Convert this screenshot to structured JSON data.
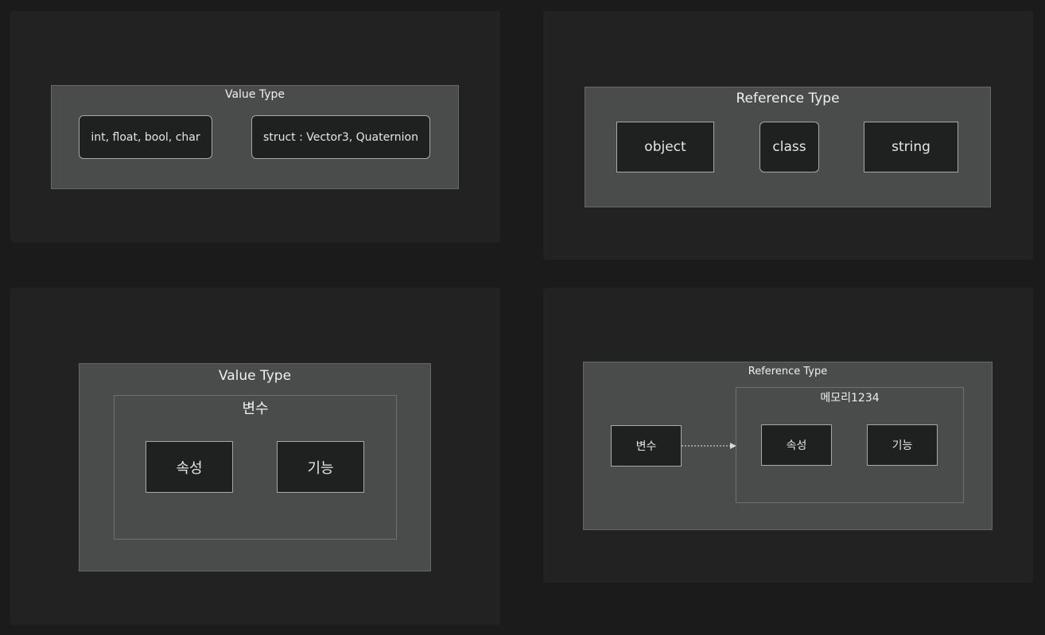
{
  "diagram_1": {
    "group_title": "Value Type",
    "nodes": [
      "int, float, bool, char",
      "struct : Vector3, Quaternion"
    ]
  },
  "diagram_2": {
    "group_title": "Reference Type",
    "nodes": [
      "object",
      "class",
      "string"
    ]
  },
  "diagram_3": {
    "group_title": "Value Type",
    "subgroup_title": "변수",
    "nodes": [
      "속성",
      "기능"
    ]
  },
  "diagram_4": {
    "group_title": "Reference Type",
    "variable_node": "변수",
    "subgroup_title": "메모리1234",
    "nodes": [
      "속성",
      "기능"
    ]
  }
}
